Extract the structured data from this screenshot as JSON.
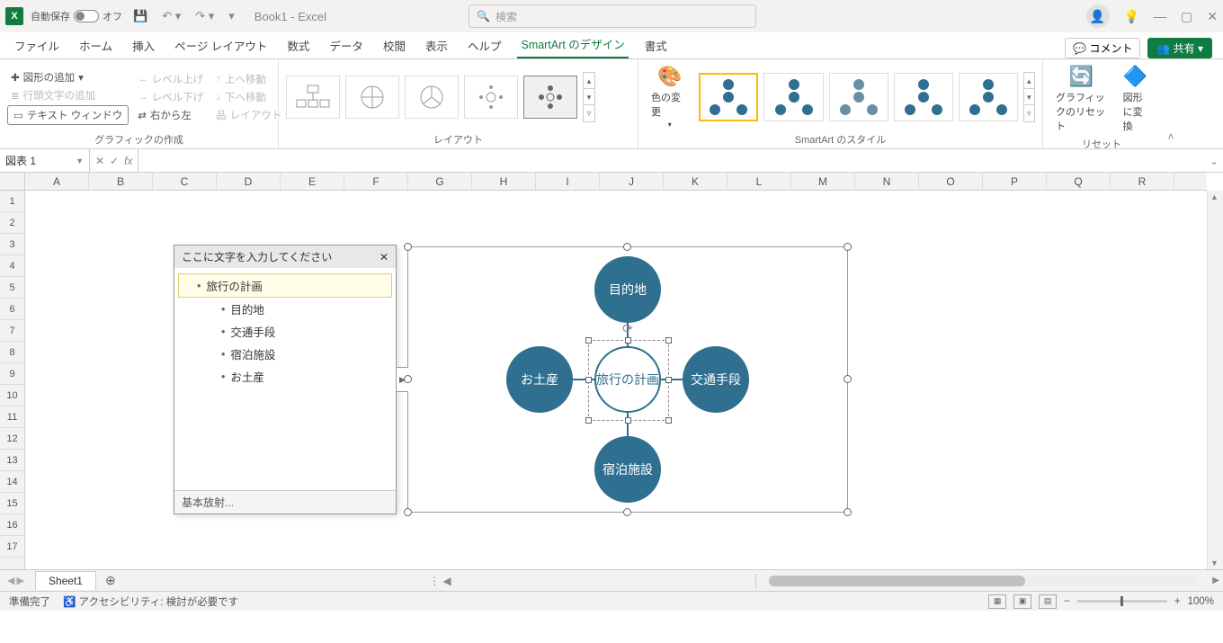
{
  "titlebar": {
    "autosave_label": "自動保存",
    "autosave_state": "オフ",
    "doc_title": "Book1 - Excel",
    "search_placeholder": "検索"
  },
  "tabs": {
    "file": "ファイル",
    "home": "ホーム",
    "insert": "挿入",
    "page_layout": "ページ レイアウト",
    "formulas": "数式",
    "data": "データ",
    "review": "校閲",
    "view": "表示",
    "help": "ヘルプ",
    "smartart_design": "SmartArt のデザイン",
    "format": "書式",
    "comment_btn": "コメント",
    "share_btn": "共有"
  },
  "ribbon": {
    "create": {
      "add_shape": "図形の追加",
      "add_bullet": "行頭文字の追加",
      "text_window": "テキスト ウィンドウ",
      "level_up": "レベル上げ",
      "level_down": "レベル下げ",
      "right_to_left": "右から左",
      "move_up": "上へ移動",
      "move_down": "下へ移動",
      "layout_menu": "レイアウト",
      "group_label": "グラフィックの作成"
    },
    "layout": {
      "group_label": "レイアウト"
    },
    "styles": {
      "change_colors": "色の変更",
      "group_label": "SmartArt のスタイル"
    },
    "reset": {
      "reset_graphic": "グラフィックのリセット",
      "to_shapes": "図形に変換",
      "group_label": "リセット"
    }
  },
  "formula_bar": {
    "name_box": "図表 1"
  },
  "columns": [
    "A",
    "B",
    "C",
    "D",
    "E",
    "F",
    "G",
    "H",
    "I",
    "J",
    "K",
    "L",
    "M",
    "N",
    "O",
    "P",
    "Q",
    "R"
  ],
  "rows": [
    "1",
    "2",
    "3",
    "4",
    "5",
    "6",
    "7",
    "8",
    "9",
    "10",
    "11",
    "12",
    "13",
    "14",
    "15",
    "16",
    "17"
  ],
  "text_pane": {
    "header": "ここに文字を入力してください",
    "items": [
      {
        "text": "旅行の計画",
        "level": 0,
        "selected": true
      },
      {
        "text": "目的地",
        "level": 1
      },
      {
        "text": "交通手段",
        "level": 1
      },
      {
        "text": "宿泊施設",
        "level": 1
      },
      {
        "text": "お土産",
        "level": 1
      }
    ],
    "footer": "基本放射..."
  },
  "smartart": {
    "center": "旅行の計画",
    "top": "目的地",
    "right": "交通手段",
    "bottom": "宿泊施設",
    "left": "お土産"
  },
  "sheet_tabs": {
    "sheet1": "Sheet1"
  },
  "status": {
    "ready": "準備完了",
    "accessibility": "アクセシビリティ: 検討が必要です",
    "zoom": "100%"
  }
}
